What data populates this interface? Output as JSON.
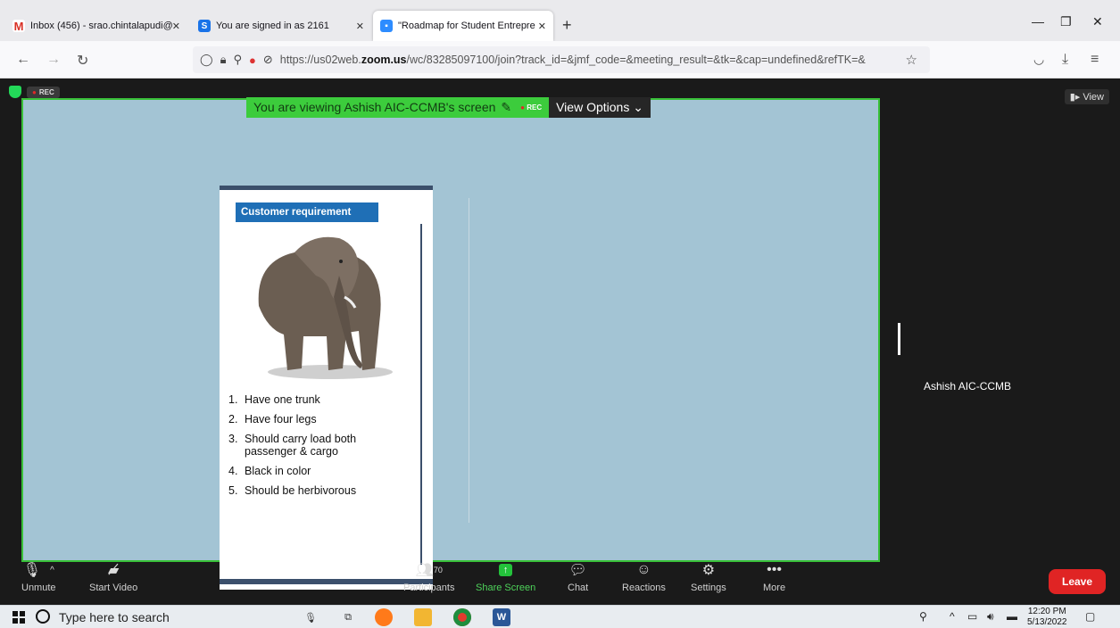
{
  "browser": {
    "tabs": [
      {
        "label": "Inbox (456) - srao.chintalapudi@",
        "icon": "gmail-icon"
      },
      {
        "label": "You are signed in as 2161",
        "icon": "s-icon"
      },
      {
        "label": "\"Roadmap for Student Entrepre",
        "icon": "zoom-icon"
      }
    ],
    "url_prefix": "https://us02web.",
    "url_domain": "zoom.us",
    "url_rest": "/wc/83285097100/join?track_id=&jmf_code=&meeting_result=&tk=&cap=undefined&refTK=&"
  },
  "meeting": {
    "rec_label": "REC",
    "viewing_text": "You are viewing Ashish AIC-CCMB's screen",
    "viewing_rec": "REC",
    "view_options": "View Options",
    "view_button": "View",
    "participant_name": "Ashish AIC-CCMB",
    "participant_count": "70"
  },
  "slide": {
    "heading": "Customer requirement",
    "items": [
      {
        "n": "1.",
        "text": "Have one trunk"
      },
      {
        "n": "2.",
        "text": "Have four legs"
      },
      {
        "n": "3.",
        "text": "Should carry load both passenger & cargo"
      },
      {
        "n": "4.",
        "text": "Black in color"
      },
      {
        "n": "5.",
        "text": "Should be herbivorous"
      }
    ]
  },
  "toolbar": {
    "unmute": "Unmute",
    "start_video": "Start Video",
    "participants": "Participants",
    "share_screen": "Share Screen",
    "chat": "Chat",
    "reactions": "Reactions",
    "settings": "Settings",
    "more": "More",
    "leave": "Leave"
  },
  "taskbar": {
    "search_placeholder": "Type here to search",
    "time": "12:20 PM",
    "date": "5/13/2022"
  },
  "colors": {
    "share_border": "#39c139",
    "share_bg": "#a3c4d4",
    "leave": "#e02424",
    "slide_heading": "#1f6fb6"
  }
}
